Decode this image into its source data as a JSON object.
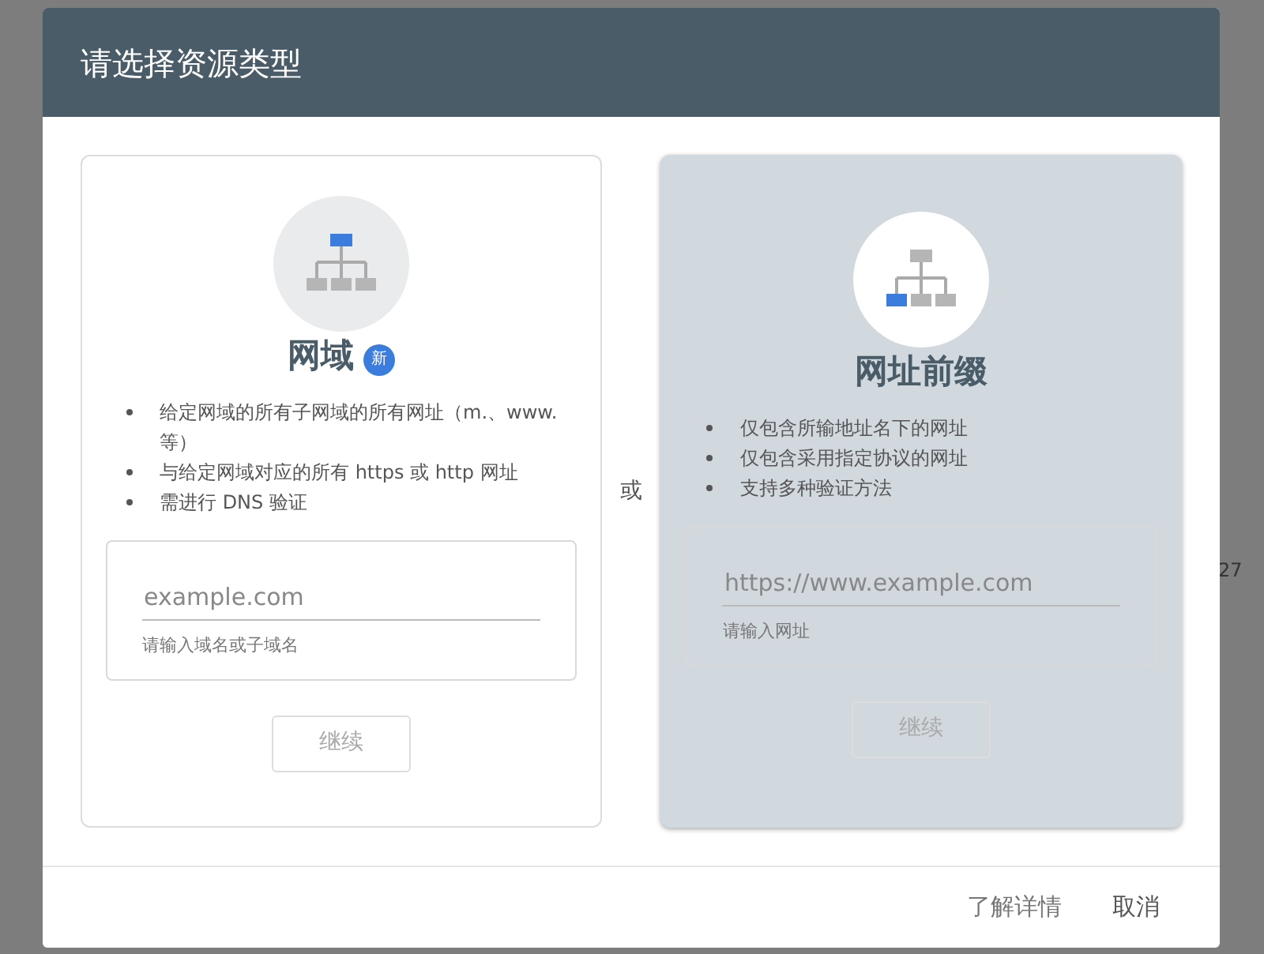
{
  "background": {
    "number": "27"
  },
  "dialog": {
    "title": "请选择资源类型",
    "options": [
      {
        "kind": "domain",
        "name": "网域",
        "badge": "新",
        "selected": false,
        "bullets": [
          "给定网域的所有子网域的所有网址（m.、www. 等）",
          "与给定网域对应的所有 https 或 http 网址",
          "需进行 DNS 验证"
        ],
        "field": {
          "placeholder": "example.com",
          "helper": "请输入域名或子域名"
        },
        "button": {
          "label": "继续",
          "disabled": true
        }
      },
      {
        "kind": "prefix",
        "name": "网址前缀",
        "selected": true,
        "bullets": [
          "仅包含所输地址名下的网址",
          "仅包含采用指定协议的网址",
          "支持多种验证方法"
        ],
        "field": {
          "placeholder": "https://www.example.com",
          "helper": "请输入网址"
        },
        "button": {
          "label": "继续",
          "disabled": true
        }
      }
    ],
    "separator": "或",
    "footer": [
      "了解详情",
      "取消"
    ]
  }
}
